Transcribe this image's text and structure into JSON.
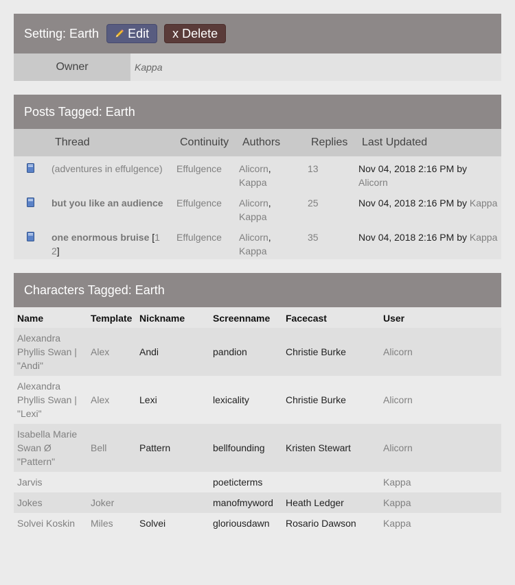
{
  "setting": {
    "title": "Setting: Earth",
    "edit_label": "Edit",
    "delete_label": "x Delete",
    "owner_label": "Owner",
    "owner_value": "Kappa"
  },
  "posts": {
    "title": "Posts Tagged: Earth",
    "columns": [
      "Thread",
      "Continuity",
      "Authors",
      "Replies",
      "Last Updated"
    ],
    "rows": [
      {
        "thread": "(adventures in effulgence)",
        "continuity": "Effulgence",
        "author1": "Alicorn",
        "author2": "Kappa",
        "replies": "13",
        "updated": "Nov 04, 2018 2:16 PM",
        "by": "by",
        "updated_by": "Alicorn"
      },
      {
        "thread": "but you like an audience",
        "continuity": "Effulgence",
        "author1": "Alicorn",
        "author2": "Kappa",
        "replies": "25",
        "updated": "Nov 04, 2018 2:16 PM",
        "by": "by",
        "updated_by": "Kappa"
      },
      {
        "thread": "one enormous bruise",
        "page1": "1",
        "page2": "2",
        "continuity": "Effulgence",
        "author1": "Alicorn",
        "author2": "Kappa",
        "replies": "35",
        "updated": "Nov 04, 2018 2:16 PM",
        "by": "by",
        "updated_by": "Kappa"
      }
    ]
  },
  "characters": {
    "title": "Characters Tagged: Earth",
    "columns": [
      "Name",
      "Template",
      "Nickname",
      "Screenname",
      "Facecast",
      "User"
    ],
    "rows": [
      {
        "name": [
          "Alexandra",
          "Phyllis Swan |",
          "\"Andi\""
        ],
        "template": "Alex",
        "nickname": "Andi",
        "screenname": "pandion",
        "facecast": "Christie Burke",
        "user": "Alicorn"
      },
      {
        "name": [
          "Alexandra",
          "Phyllis Swan |",
          "\"Lexi\""
        ],
        "template": "Alex",
        "nickname": "Lexi",
        "screenname": "lexicality",
        "facecast": "Christie Burke",
        "user": "Alicorn"
      },
      {
        "name": [
          "Isabella Marie",
          "Swan Ø",
          "\"Pattern\""
        ],
        "template": "Bell",
        "nickname": "Pattern",
        "screenname": "bellfounding",
        "facecast": "Kristen Stewart",
        "user": "Alicorn"
      },
      {
        "name": [
          "Jarvis"
        ],
        "template": "",
        "nickname": "",
        "screenname": "poeticterms",
        "facecast": "",
        "user": "Kappa"
      },
      {
        "name": [
          "Jokes"
        ],
        "template": "Joker",
        "nickname": "",
        "screenname": "manofmyword",
        "facecast": "Heath Ledger",
        "user": "Kappa"
      },
      {
        "name": [
          "Solvei Koskin"
        ],
        "template": "Miles",
        "nickname": "Solvei",
        "screenname": "gloriousdawn",
        "facecast": "Rosario Dawson",
        "user": "Kappa"
      }
    ]
  },
  "colors": {
    "header_bg": "#8d8888",
    "edit_button": "#585c80",
    "delete_button": "#5a3b39"
  }
}
